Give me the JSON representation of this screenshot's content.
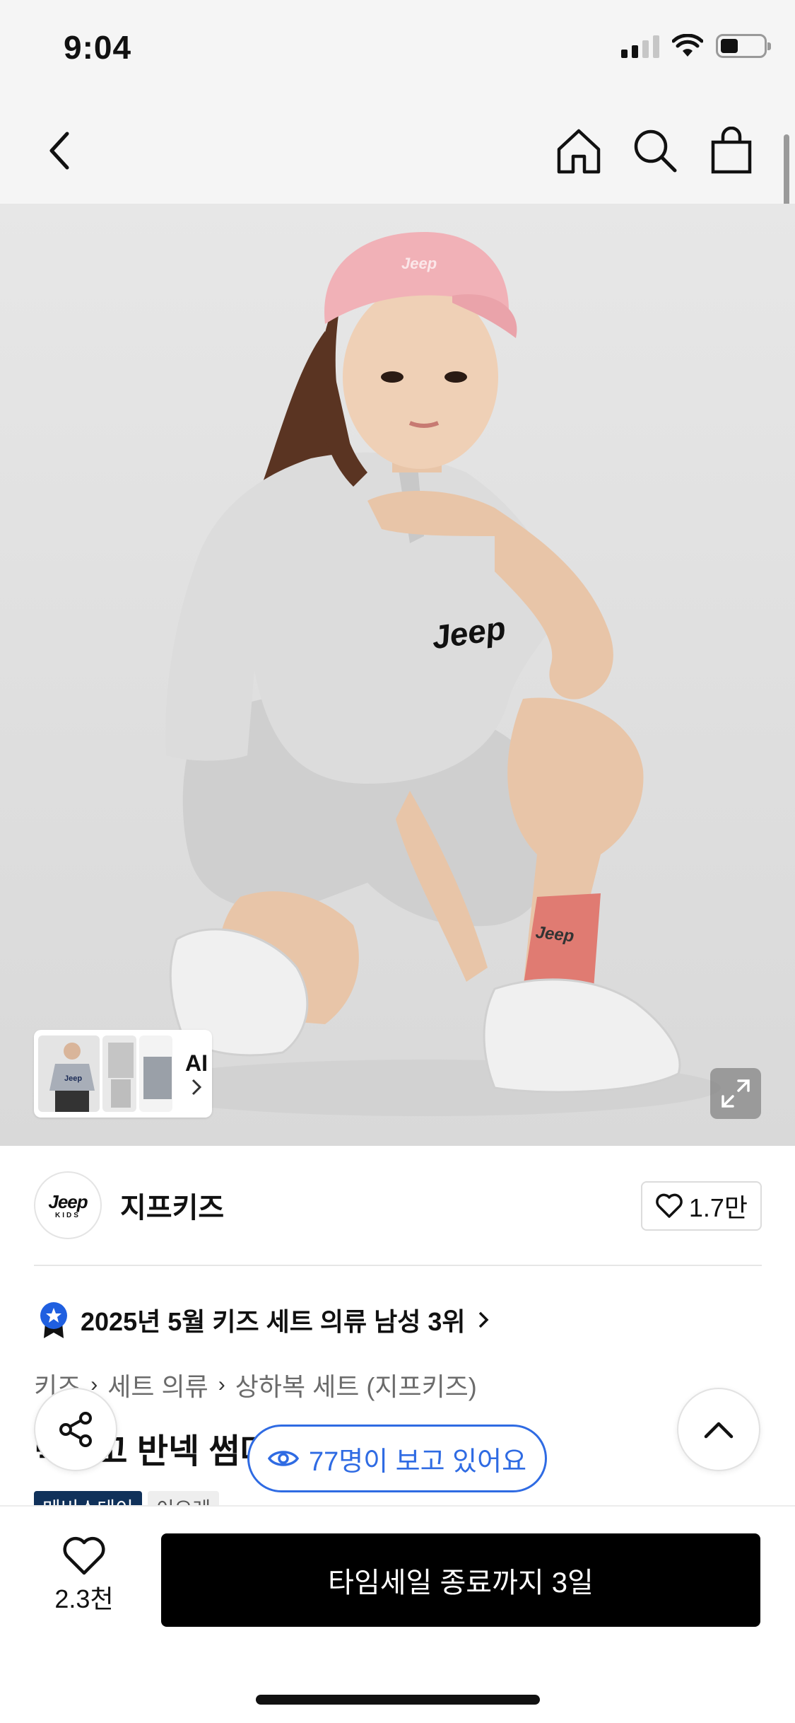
{
  "status_bar": {
    "time": "9:04"
  },
  "nav": {
    "back_icon": "chevron-left-icon",
    "home_icon": "home-icon",
    "search_icon": "search-icon",
    "cart_icon": "shopping-bag-icon"
  },
  "hero": {
    "thumbnail_logo_text": "Jeep",
    "ai_label": "AI",
    "expand_icon": "expand-icon"
  },
  "brand": {
    "logo_line1": "Jeep",
    "logo_line2": "KIDS",
    "name": "지프키즈",
    "likes": "1.7만"
  },
  "ranking": {
    "text": "2025년 5월 키즈 세트 의류 남성 3위"
  },
  "breadcrumb": [
    "키즈",
    "세트 의류",
    "상하복 세트 (지프키즈)"
  ],
  "product": {
    "title": "빅로고 반넥 썸머",
    "tags": [
      "메비스테이",
      "이으레"
    ]
  },
  "viewers": {
    "text": "77명이 보고 있어요"
  },
  "bottom": {
    "wish_count": "2.3천",
    "cta_label": "타임세일 종료까지 3일"
  },
  "colors": {
    "accent_blue": "#2f6be3",
    "tag_dark": "#10315a",
    "cta_bg": "#000000",
    "badge_blue": "#1f5fe0"
  }
}
